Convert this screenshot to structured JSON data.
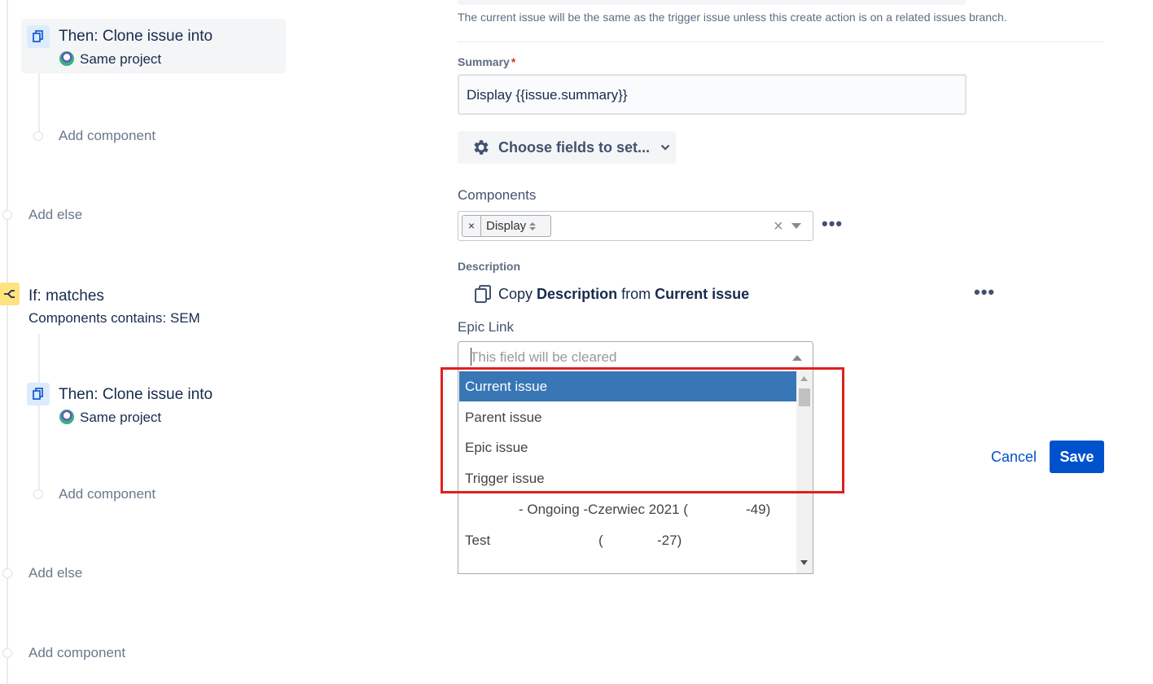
{
  "rule_tree": {
    "action1": {
      "title": "Then: Clone issue into",
      "subtitle": "Same project",
      "selected": true
    },
    "add_component_1": "Add component",
    "add_else_1": "Add else",
    "condition": {
      "title": "If: matches",
      "subtitle": "Components contains: SEM"
    },
    "action2": {
      "title": "Then: Clone issue into",
      "subtitle": "Same project"
    },
    "add_component_2": "Add component",
    "add_else_2": "Add else",
    "add_component_3": "Add component"
  },
  "form": {
    "help_text": "The current issue will be the same as the trigger issue unless this create action is on a related issues branch.",
    "summary": {
      "label": "Summary",
      "required_mark": "*",
      "value": "Display {{issue.summary}}"
    },
    "choose_fields_label": "Choose fields to set...",
    "components": {
      "label": "Components",
      "chips": [
        "Display"
      ],
      "clear_glyph": "×"
    },
    "description": {
      "label": "Description",
      "copy_prefix": "Copy",
      "field": "Description",
      "from_word": "from",
      "source": "Current issue"
    },
    "epic_link": {
      "label": "Epic Link",
      "placeholder": "This field will be cleared",
      "options": [
        {
          "label": "Current issue",
          "selected": true
        },
        {
          "label": "Parent issue",
          "selected": false
        },
        {
          "label": "Epic issue",
          "selected": false
        },
        {
          "label": "Trigger issue",
          "selected": false
        }
      ],
      "extra_options": [
        {
          "left": "",
          "mid": "- Ongoing -Czerwiec 2021 (",
          "right": "-49)"
        },
        {
          "left": "Test",
          "mid": "(",
          "right": "-27)"
        }
      ]
    },
    "cancel_label": "Cancel",
    "save_label": "Save"
  },
  "colors": {
    "primary": "#0052cc",
    "selected_option": "#3876b6",
    "highlight_box": "#e0201c",
    "condition_icon": "#ffe380"
  },
  "icons": [
    "clone-icon",
    "project-avatar-icon",
    "branch-icon",
    "gear-icon",
    "chevron-down-icon",
    "copy-icon",
    "more-icon",
    "sort-icon",
    "clear-icon",
    "caret-down-icon",
    "caret-up-icon"
  ]
}
